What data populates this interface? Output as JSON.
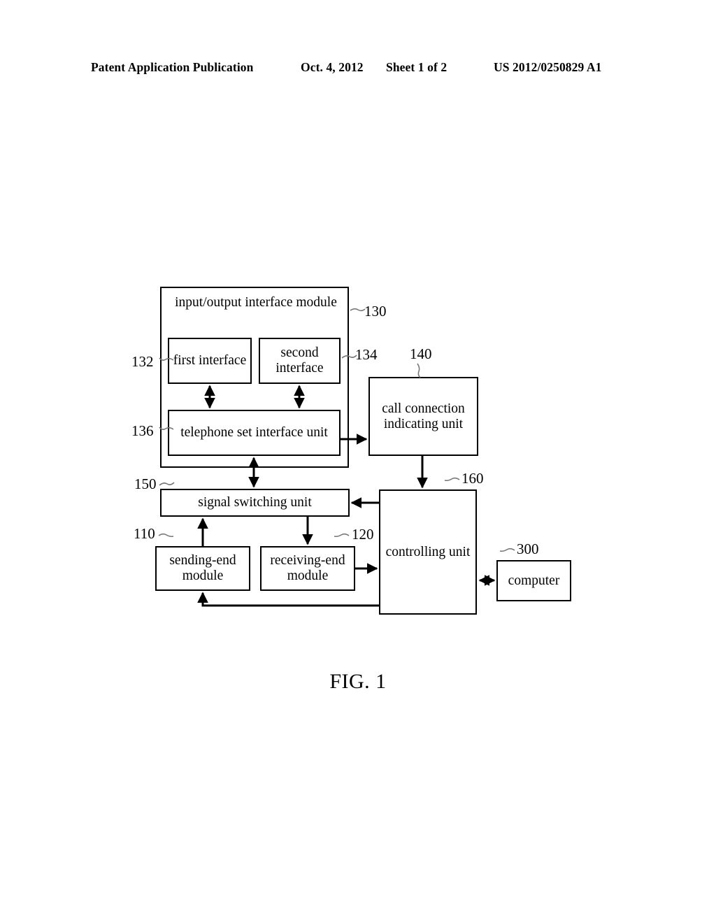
{
  "header": {
    "publication": "Patent Application Publication",
    "date": "Oct. 4, 2012",
    "sheet": "Sheet 1 of 2",
    "doc_number": "US 2012/0250829 A1"
  },
  "figure": {
    "caption": "FIG. 1",
    "blocks": [
      {
        "ref": "130",
        "label": "input/output interface module"
      },
      {
        "ref": "132",
        "label": "first interface"
      },
      {
        "ref": "134",
        "label": "second interface"
      },
      {
        "ref": "136",
        "label": "telephone set interface unit"
      },
      {
        "ref": "140",
        "label": "call connection indicating unit"
      },
      {
        "ref": "150",
        "label": "signal switching unit"
      },
      {
        "ref": "110",
        "label": "sending-end module"
      },
      {
        "ref": "120",
        "label": "receiving-end module"
      },
      {
        "ref": "160",
        "label": "controlling unit"
      },
      {
        "ref": "300",
        "label": "computer"
      }
    ],
    "connections": [
      {
        "from": "136",
        "to": "132",
        "type": "bidirectional"
      },
      {
        "from": "136",
        "to": "134",
        "type": "bidirectional"
      },
      {
        "from": "136",
        "to": "150",
        "type": "bidirectional"
      },
      {
        "from": "136",
        "to": "140",
        "type": "unidirectional"
      },
      {
        "from": "140",
        "to": "160",
        "type": "unidirectional"
      },
      {
        "from": "160",
        "to": "150",
        "type": "unidirectional"
      },
      {
        "from": "150",
        "to": "120",
        "type": "unidirectional"
      },
      {
        "from": "110",
        "to": "150",
        "type": "unidirectional"
      },
      {
        "from": "120",
        "to": "160",
        "type": "unidirectional"
      },
      {
        "from": "160",
        "to": "110",
        "type": "unidirectional"
      },
      {
        "from": "160",
        "to": "300",
        "type": "bidirectional"
      }
    ]
  }
}
